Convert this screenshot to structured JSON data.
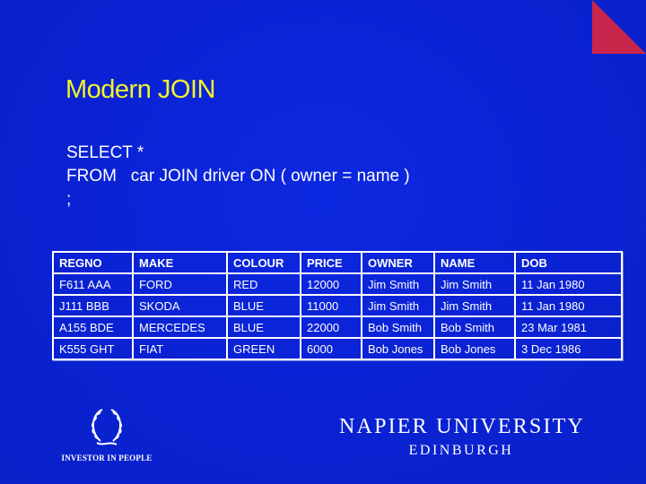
{
  "slide": {
    "title": "Modern JOIN",
    "accent_color": "#c8254a",
    "title_color": "#f4f42a",
    "background_color": "#0a22d6"
  },
  "sql": {
    "lines": [
      "SELECT *",
      "FROM   car JOIN driver ON ( owner = name )",
      ";"
    ]
  },
  "table": {
    "headers": [
      "REGNO",
      "MAKE",
      "COLOUR",
      "PRICE",
      "OWNER",
      "NAME",
      "DOB"
    ],
    "rows": [
      [
        "F611 AAA",
        "FORD",
        "RED",
        "12000",
        "Jim Smith",
        "Jim Smith",
        "11 Jan 1980"
      ],
      [
        "J111 BBB",
        "SKODA",
        "BLUE",
        "11000",
        "Jim Smith",
        "Jim Smith",
        "11 Jan 1980"
      ],
      [
        "A155 BDE",
        "MERCEDES",
        "BLUE",
        "22000",
        "Bob Smith",
        "Bob Smith",
        "23 Mar 1981"
      ],
      [
        "K555 GHT",
        "FIAT",
        "GREEN",
        "6000",
        "Bob Jones",
        "Bob Jones",
        "3 Dec 1986"
      ]
    ]
  },
  "footer": {
    "investor_logo_icon": "laurel-wreath-icon",
    "investor_label": "INVESTOR IN PEOPLE",
    "university_name": "NAPIER UNIVERSITY",
    "university_city": "EDINBURGH"
  }
}
